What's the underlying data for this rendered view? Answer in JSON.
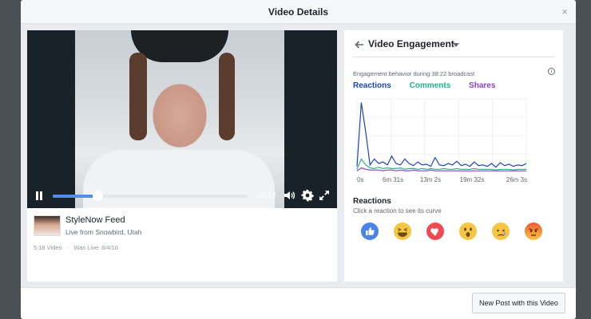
{
  "modal": {
    "title": "Video Details",
    "close_label": "×"
  },
  "player": {
    "time_remaining": "-00:12",
    "progress": 0.23
  },
  "post": {
    "page_name": "StyleNow Feed",
    "location": "Live from Snowbird, Utah",
    "duration": "5:18 Video",
    "separator": "·",
    "was_live": "Was Live: 8/4/16"
  },
  "engagement": {
    "title": "Video Engagement",
    "description": "Engagement behavior during 38:22 broadcast",
    "info_label": "i",
    "legend": [
      {
        "label": "Reactions",
        "color": "#1c46b6"
      },
      {
        "label": "Comments",
        "color": "#22b28d"
      },
      {
        "label": "Shares",
        "color": "#8a3fc9"
      }
    ]
  },
  "chart_data": {
    "type": "line",
    "x": [
      "0s",
      "6m 31s",
      "13m 2s",
      "19m 32s",
      "26m 3s"
    ],
    "ylim": [
      0,
      100
    ],
    "grid": true,
    "series": [
      {
        "name": "Reactions",
        "values": [
          8,
          95,
          55,
          10,
          18,
          12,
          14,
          10,
          22,
          12,
          10,
          18,
          12,
          9,
          14,
          10,
          11,
          8,
          20,
          10,
          9,
          12,
          10,
          15,
          9,
          11,
          8,
          14,
          9,
          10,
          8,
          12,
          7,
          13,
          9,
          11,
          8,
          10,
          9,
          12
        ]
      },
      {
        "name": "Comments",
        "values": [
          4,
          18,
          10,
          6,
          5,
          7,
          5,
          6,
          5,
          5,
          6,
          4,
          5,
          5,
          4,
          5,
          4,
          5,
          4,
          4,
          5,
          4,
          4,
          5,
          4,
          4,
          4,
          5,
          4,
          4,
          4,
          4,
          3,
          4,
          4,
          4,
          3,
          4,
          4,
          4
        ]
      },
      {
        "name": "Shares",
        "values": [
          2,
          6,
          4,
          3,
          3,
          3,
          2,
          3,
          3,
          2,
          3,
          2,
          2,
          3,
          2,
          2,
          2,
          3,
          2,
          2,
          2,
          2,
          2,
          2,
          2,
          2,
          2,
          2,
          2,
          2,
          2,
          2,
          2,
          2,
          2,
          2,
          2,
          2,
          2,
          2
        ]
      }
    ]
  },
  "reactions": {
    "title": "Reactions",
    "subtitle": "Click a reaction to see its curve",
    "items": [
      {
        "name": "like",
        "color": "#4a84e9"
      },
      {
        "name": "haha",
        "color": "#f6c544"
      },
      {
        "name": "love",
        "color": "#ee4a55"
      },
      {
        "name": "wow",
        "color": "#f6c544"
      },
      {
        "name": "sad",
        "color": "#f6c544"
      },
      {
        "name": "angry",
        "color": "#f08a3b"
      }
    ]
  },
  "footer": {
    "new_post_label": "New Post with this Video"
  }
}
